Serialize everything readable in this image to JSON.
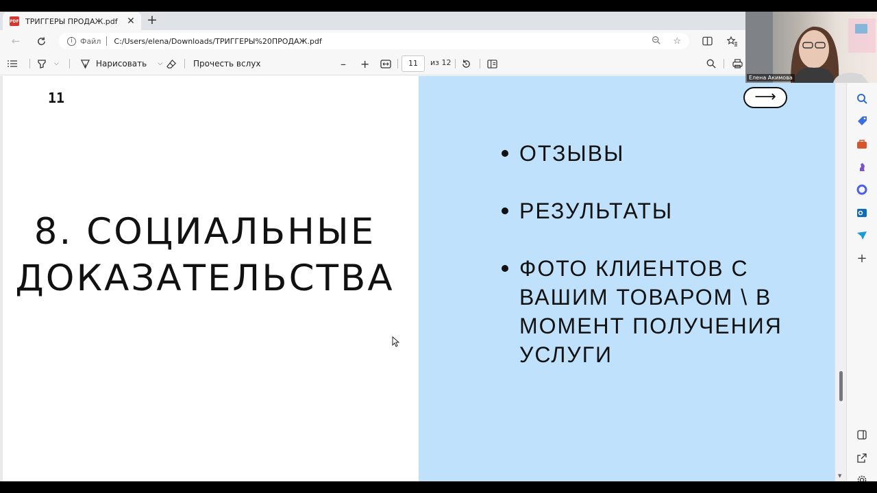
{
  "browser": {
    "tab_title": "ТРИГГЕРЫ ПРОДАЖ.pdf",
    "tab_icon_text": "PDF",
    "scheme_label": "Файл",
    "url": "C:/Users/elena/Downloads/ТРИГГЕРЫ%20ПРОДАЖ.pdf"
  },
  "pdf_toolbar": {
    "draw_label": "Нарисовать",
    "read_aloud_label": "Прочесть вслух",
    "current_page": "11",
    "total_pages": "из 12"
  },
  "slide": {
    "page_number": "11",
    "heading_line1": "8. СОЦИАЛЬНЫЕ",
    "heading_line2": "ДОКАЗАТЕЛЬСТВА",
    "arrow": "⟶",
    "bullets": [
      "ОТЗЫВЫ",
      "РЕЗУЛЬТАТЫ",
      "ФОТО КЛИЕНТОВ С ВАШИМ ТОВАРОМ \\ В МОМЕНТ ПОЛУЧЕНИЯ УСЛУГИ"
    ],
    "left_bg": "#ffffff",
    "right_bg": "#bfe1fb"
  },
  "webcam": {
    "participant_name": "Елена Акимова"
  },
  "scroll_position": 0.82
}
